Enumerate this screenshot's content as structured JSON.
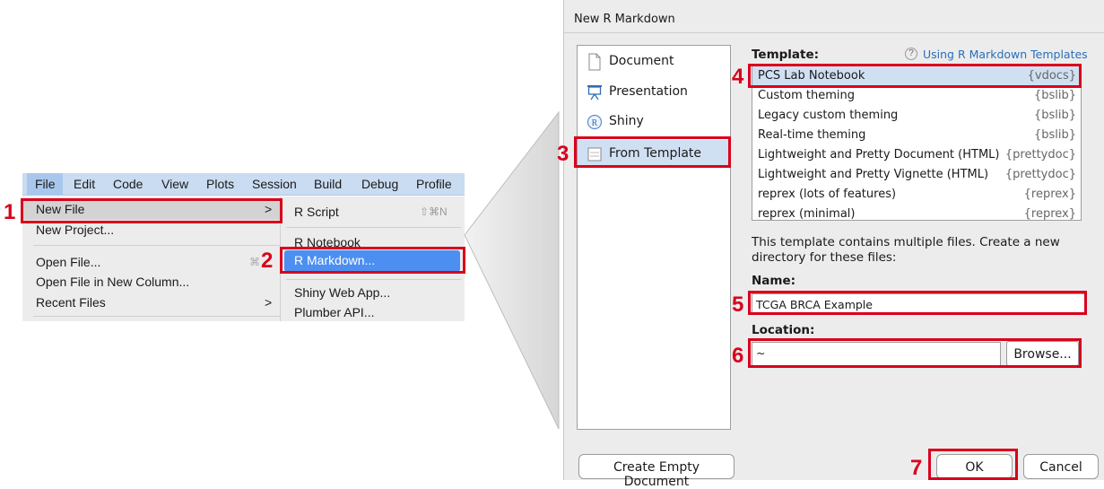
{
  "menubar": {
    "items": [
      "File",
      "Edit",
      "Code",
      "View",
      "Plots",
      "Session",
      "Build",
      "Debug",
      "Profile"
    ]
  },
  "file_menu": {
    "items": [
      {
        "label": "New File",
        "arrow": ">"
      },
      {
        "label": "New Project..."
      },
      {
        "label": "Open File...",
        "shortcut": "⌘"
      },
      {
        "label": "Open File in New Column..."
      },
      {
        "label": "Recent Files",
        "arrow": ">"
      }
    ]
  },
  "new_file_submenu": {
    "items": [
      {
        "label": "R Script",
        "shortcut": "⇧⌘N"
      },
      {
        "label": "R Notebook"
      },
      {
        "label": "R Markdown..."
      },
      {
        "label": "Shiny Web App..."
      },
      {
        "label": "Plumber API..."
      }
    ]
  },
  "dialog": {
    "title": "New R Markdown",
    "doc_types": [
      "Document",
      "Presentation",
      "Shiny",
      "From Template"
    ],
    "template_label": "Template:",
    "help_link": "Using R Markdown Templates",
    "templates": [
      {
        "name": "PCS Lab Notebook",
        "pkg": "{vdocs}"
      },
      {
        "name": "Custom theming",
        "pkg": "{bslib}"
      },
      {
        "name": "Legacy custom theming",
        "pkg": "{bslib}"
      },
      {
        "name": "Real-time theming",
        "pkg": "{bslib}"
      },
      {
        "name": "Lightweight and Pretty Document (HTML)",
        "pkg": "{prettydoc}"
      },
      {
        "name": "Lightweight and Pretty Vignette (HTML)",
        "pkg": "{prettydoc}"
      },
      {
        "name": "reprex (lots of features)",
        "pkg": "{reprex}"
      },
      {
        "name": "reprex (minimal)",
        "pkg": "{reprex}"
      }
    ],
    "description": "This template contains multiple files. Create a new directory for these files:",
    "name_label": "Name:",
    "name_value": "TCGA BRCA Example",
    "location_label": "Location:",
    "location_value": "~",
    "browse_label": "Browse...",
    "create_empty_label": "Create Empty Document",
    "ok_label": "OK",
    "cancel_label": "Cancel"
  },
  "steps": [
    "1",
    "2",
    "3",
    "4",
    "5",
    "6",
    "7"
  ],
  "colors": {
    "callout_red": "#d9001b",
    "selection_blue": "#4c8ff0",
    "list_selected": "#cfe0f3",
    "link_blue": "#2a6ebb"
  }
}
